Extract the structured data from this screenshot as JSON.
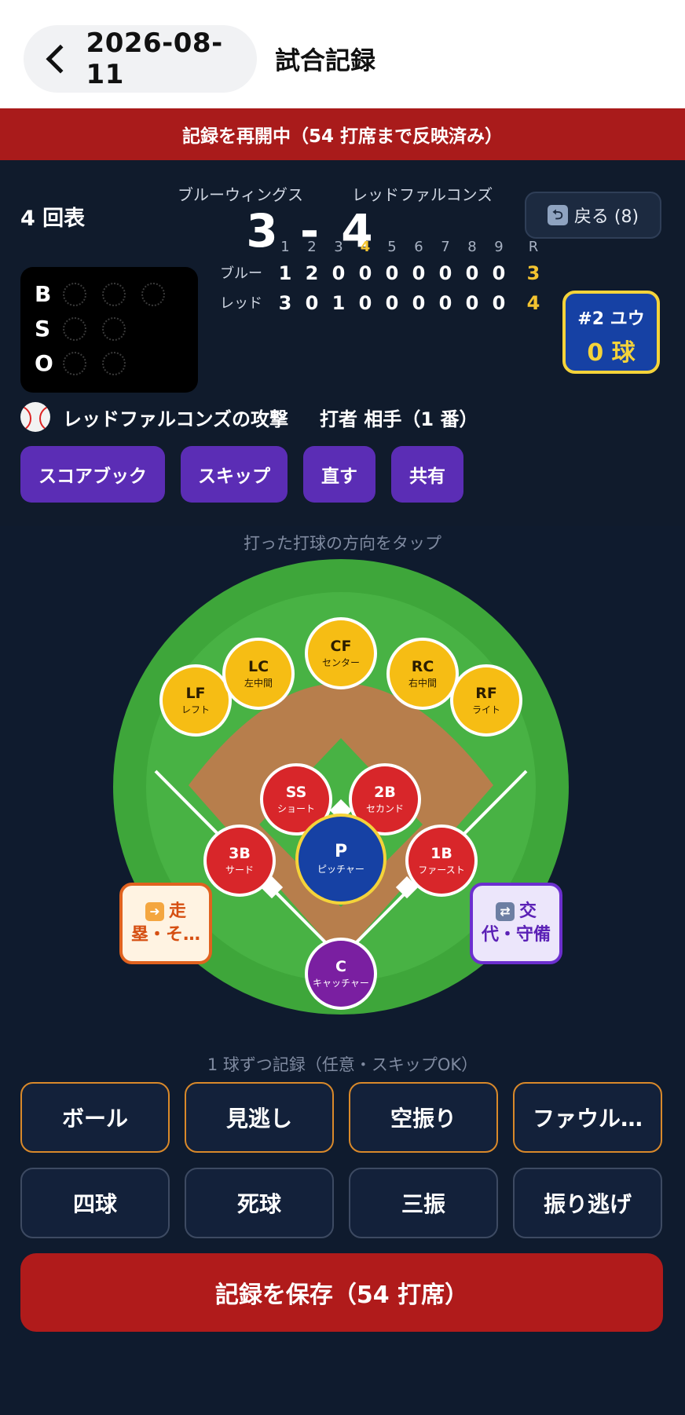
{
  "header": {
    "date": "2026-08-11",
    "title": "試合記録"
  },
  "banner": {
    "text": "記録を再開中（54 打席まで反映済み）"
  },
  "scoreboard": {
    "inning": "4 回表",
    "away_team": "ブルーウィングス",
    "home_team": "レッドファルコンズ",
    "score": "3 - 4",
    "undo_label": "戻る (8)",
    "bso_labels": [
      "B",
      "S",
      "O"
    ],
    "balls": 0,
    "strikes": 0,
    "outs": 0,
    "linescore": {
      "innings": [
        "1",
        "2",
        "3",
        "4",
        "5",
        "6",
        "7",
        "8",
        "9",
        "R"
      ],
      "current_inning": 4,
      "away": {
        "name": "ブルー",
        "runs": [
          "1",
          "2",
          "0",
          "0",
          "0",
          "0",
          "0",
          "0",
          "0"
        ],
        "total": "3"
      },
      "home": {
        "name": "レッド",
        "runs": [
          "3",
          "0",
          "1",
          "0",
          "0",
          "0",
          "0",
          "0",
          "0"
        ],
        "total": "4"
      }
    },
    "pitcher": {
      "name": "#2 ユウ",
      "count": "0 球"
    }
  },
  "attack": {
    "team_text": "レッドファルコンズの攻撃",
    "batter_text": "打者 相手（1 番）"
  },
  "actions": [
    "スコアブック",
    "スキップ",
    "直す",
    "共有"
  ],
  "field": {
    "hint": "打った打球の方向をタップ",
    "positions": {
      "LF": {
        "ab": "LF",
        "name": "レフト"
      },
      "LC": {
        "ab": "LC",
        "name": "左中間"
      },
      "CF": {
        "ab": "CF",
        "name": "センター"
      },
      "RC": {
        "ab": "RC",
        "name": "右中間"
      },
      "RF": {
        "ab": "RF",
        "name": "ライト"
      },
      "SS": {
        "ab": "SS",
        "name": "ショート"
      },
      "2B": {
        "ab": "2B",
        "name": "セカンド"
      },
      "3B": {
        "ab": "3B",
        "name": "サード"
      },
      "P": {
        "ab": "P",
        "name": "ピッチャー"
      },
      "1B": {
        "ab": "1B",
        "name": "ファースト"
      },
      "C": {
        "ab": "C",
        "name": "キャッチャー"
      }
    },
    "run_button": {
      "line1": "走",
      "line2": "塁・そ…"
    },
    "sub_button": {
      "line1": "交",
      "line2": "代・守備"
    }
  },
  "pitches": {
    "hint": "1 球ずつ記録（任意・スキップOK）",
    "row1": [
      "ボール",
      "見逃し",
      "空振り",
      "ファウル…"
    ],
    "row2": [
      "四球",
      "死球",
      "三振",
      "振り逃げ"
    ]
  },
  "save_label": "記録を保存（54 打席）",
  "colors": {
    "banner_red": "#a91b1b",
    "action_purple": "#5b2db5",
    "outfield_yellow": "#f6bd14",
    "infield_red": "#d8262a",
    "pitcher_blue": "#1641a4",
    "catcher_purple": "#7a1fa1",
    "field_green": "#3ea63a"
  }
}
